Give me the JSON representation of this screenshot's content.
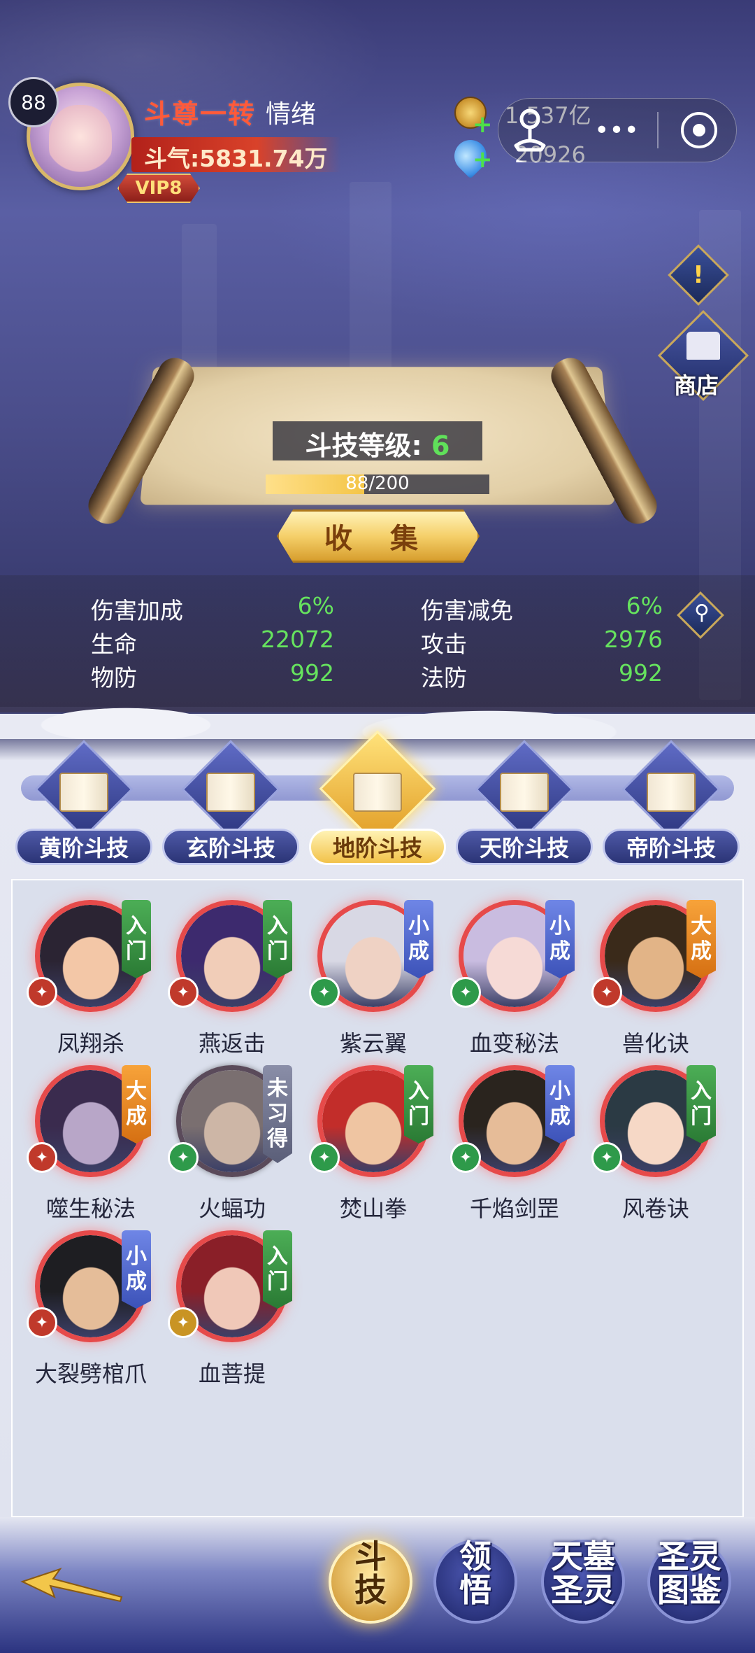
{
  "player": {
    "level": "88",
    "rank_title": "斗尊一转",
    "mood_label": "情绪",
    "power_text": "斗气:5831.74万",
    "vip": "VIP8"
  },
  "currency": {
    "gold": "1.537亿",
    "gems": "20926"
  },
  "capsule": {
    "more": "•••"
  },
  "side_buttons": {
    "notice": "!",
    "shop_label": "商店"
  },
  "scroll": {
    "level_label": "斗技等级:",
    "level_value": "6",
    "progress_text": "88/200",
    "progress_fraction": 0.44,
    "collect_label": "收 集"
  },
  "stats": [
    {
      "label": "伤害加成",
      "value": "6%"
    },
    {
      "label": "伤害减免",
      "value": "6%"
    },
    {
      "label": "生命",
      "value": "22072"
    },
    {
      "label": "攻击",
      "value": "2976"
    },
    {
      "label": "物防",
      "value": "992"
    },
    {
      "label": "法防",
      "value": "992"
    }
  ],
  "tabs": [
    {
      "label": "黄阶斗技",
      "active": false
    },
    {
      "label": "玄阶斗技",
      "active": false
    },
    {
      "label": "地阶斗技",
      "active": true
    },
    {
      "label": "天阶斗技",
      "active": false
    },
    {
      "label": "帝阶斗技",
      "active": false
    }
  ],
  "skills": [
    {
      "name": "凤翔杀",
      "tag": [
        "入",
        "门"
      ],
      "tag_color": "green",
      "type": "red",
      "face": "#f3c7a7",
      "hair": "#2b2433"
    },
    {
      "name": "燕返击",
      "tag": [
        "入",
        "门"
      ],
      "tag_color": "green",
      "type": "red",
      "face": "#f1cdb8",
      "hair": "#3d2a6e"
    },
    {
      "name": "紫云翼",
      "tag": [
        "小",
        "成"
      ],
      "tag_color": "blue",
      "type": "green",
      "face": "#efd2c4",
      "hair": "#d8d8e4"
    },
    {
      "name": "血变秘法",
      "tag": [
        "小",
        "成"
      ],
      "tag_color": "blue",
      "type": "green",
      "face": "#f6dad6",
      "hair": "#c9bce0"
    },
    {
      "name": "兽化诀",
      "tag": [
        "大",
        "成"
      ],
      "tag_color": "orange",
      "type": "red",
      "face": "#e2b487",
      "hair": "#3a2a1a"
    },
    {
      "name": "噬生秘法",
      "tag": [
        "大",
        "成"
      ],
      "tag_color": "orange",
      "type": "red",
      "face": "#b8a6c8",
      "hair": "#3a2b4e"
    },
    {
      "name": "火蝠功",
      "tag": [
        "未",
        "习",
        "得"
      ],
      "tag_color": "gray",
      "type": "green",
      "face": "#cdb6a6",
      "hair": "#7a6f70",
      "dark": true
    },
    {
      "name": "焚山拳",
      "tag": [
        "入",
        "门"
      ],
      "tag_color": "green",
      "type": "green",
      "face": "#efc5a2",
      "hair": "#c22d2a"
    },
    {
      "name": "千焰剑罡",
      "tag": [
        "小",
        "成"
      ],
      "tag_color": "blue",
      "type": "green",
      "face": "#e6bc98",
      "hair": "#2a241e"
    },
    {
      "name": "风卷诀",
      "tag": [
        "入",
        "门"
      ],
      "tag_color": "green",
      "type": "green",
      "face": "#f6d8c6",
      "hair": "#2b3a44"
    },
    {
      "name": "大裂劈棺爪",
      "tag": [
        "小",
        "成"
      ],
      "tag_color": "blue",
      "type": "red",
      "face": "#e5bd99",
      "hair": "#1e1e22"
    },
    {
      "name": "血菩提",
      "tag": [
        "入",
        "门"
      ],
      "tag_color": "green",
      "type": "gold",
      "face": "#f0c8b8",
      "hair": "#8a1f28"
    }
  ],
  "bottom_nav": [
    {
      "label_lines": [
        "斗",
        "技"
      ],
      "active": true
    },
    {
      "label_lines": [
        "领",
        "悟"
      ],
      "active": false
    },
    {
      "label_lines": [
        "天墓",
        "圣灵"
      ],
      "active": false
    },
    {
      "label_lines": [
        "圣灵",
        "图鉴"
      ],
      "active": false
    }
  ]
}
